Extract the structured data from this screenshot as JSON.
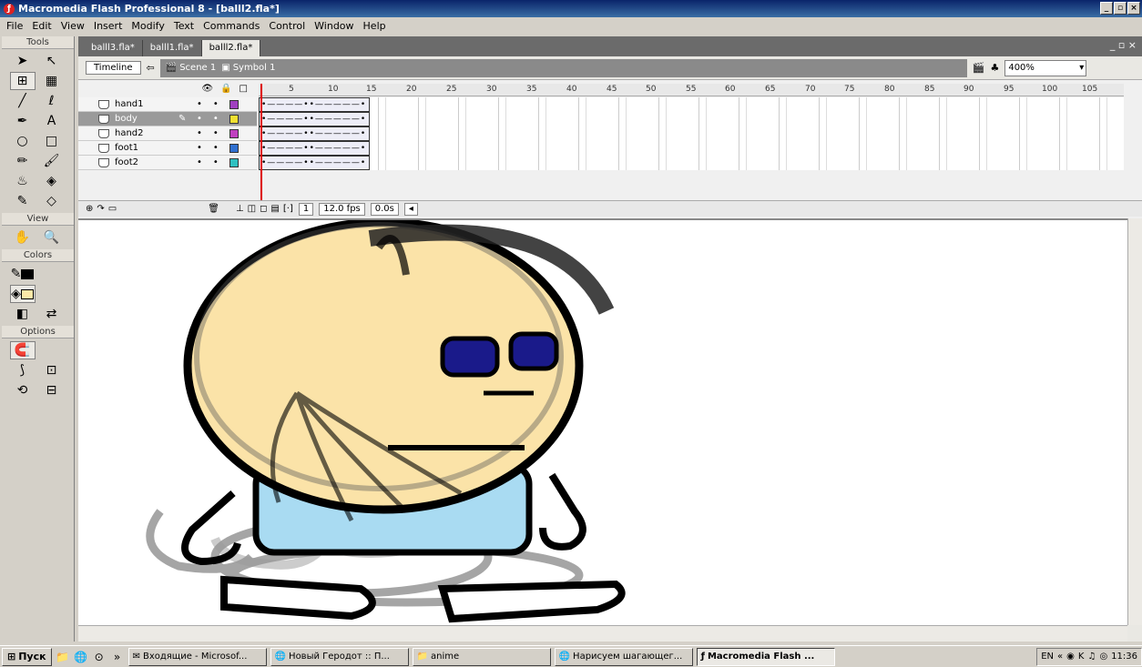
{
  "window": {
    "title": "Macromedia Flash Professional 8 - [balll2.fla*]",
    "controls": [
      "_",
      "▫",
      "×"
    ]
  },
  "menu": [
    "File",
    "Edit",
    "View",
    "Insert",
    "Modify",
    "Text",
    "Commands",
    "Control",
    "Window",
    "Help"
  ],
  "tools": {
    "header": "Tools",
    "view_header": "View",
    "colors_header": "Colors",
    "options_header": "Options"
  },
  "tabs": [
    "balll3.fla*",
    "balll1.fla*",
    "balll2.fla*"
  ],
  "nav": {
    "timeline_btn": "Timeline",
    "scene": "Scene 1",
    "symbol": "Symbol 1",
    "zoom": "400%"
  },
  "timeline": {
    "ruler": [
      "5",
      "10",
      "15",
      "20",
      "25",
      "30",
      "35",
      "40",
      "45",
      "50",
      "55",
      "60",
      "65",
      "70",
      "75",
      "80",
      "85",
      "90",
      "95",
      "100",
      "105"
    ],
    "layers": [
      {
        "name": "hand1",
        "color": "#a040c0"
      },
      {
        "name": "body",
        "color": "#f0e030"
      },
      {
        "name": "hand2",
        "color": "#c040c0"
      },
      {
        "name": "foot1",
        "color": "#3070d0"
      },
      {
        "name": "foot2",
        "color": "#30c0c0"
      }
    ],
    "frame_glyphs": "•————••—————•",
    "current_frame": "1",
    "fps": "12.0 fps",
    "time": "0.0s"
  },
  "taskbar": {
    "start": "Пуск",
    "tasks": [
      "Входящие - Microsof...",
      "Новый Геродот :: П...",
      "anime",
      "Нарисуем шагающег...",
      "Macromedia Flash ..."
    ],
    "lang": "EN",
    "clock": "11:36"
  }
}
